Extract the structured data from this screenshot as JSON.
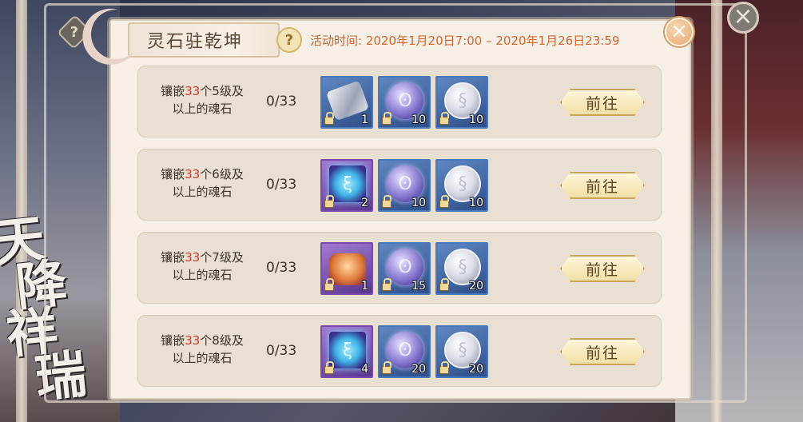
{
  "background": {
    "calligraphy": [
      "天",
      "降",
      "祥",
      "瑞"
    ]
  },
  "outer": {
    "help_icon": "?",
    "close_icon": "×"
  },
  "panel": {
    "title": "灵石驻乾坤",
    "help_icon": "?",
    "event_time_label": "活动时间:",
    "event_time_value": "2020年1月20日7:00 – 2020年1月26日23:59",
    "close_icon": "×"
  },
  "tasks": [
    {
      "desc_prefix": "镶嵌",
      "count": "33",
      "desc_suffix": "个5级及",
      "desc_line2": "以上的魂石",
      "progress": "0/33",
      "rewards": [
        {
          "icon": "crystal-shard-icon",
          "qty": "1"
        },
        {
          "icon": "purple-orb-icon",
          "qty": "10"
        },
        {
          "icon": "silver-coin-icon",
          "qty": "10"
        }
      ],
      "button": "前往"
    },
    {
      "desc_prefix": "镶嵌",
      "count": "33",
      "desc_suffix": "个6级及",
      "desc_line2": "以上的魂石",
      "progress": "0/33",
      "rewards": [
        {
          "icon": "rune-stone-icon",
          "qty": "2"
        },
        {
          "icon": "purple-orb-icon",
          "qty": "10"
        },
        {
          "icon": "silver-coin-icon",
          "qty": "10"
        }
      ],
      "button": "前往"
    },
    {
      "desc_prefix": "镶嵌",
      "count": "33",
      "desc_suffix": "个7级及",
      "desc_line2": "以上的魂石",
      "progress": "0/33",
      "rewards": [
        {
          "icon": "lantern-chest-icon",
          "qty": "1"
        },
        {
          "icon": "purple-orb-icon",
          "qty": "15"
        },
        {
          "icon": "silver-coin-icon",
          "qty": "20"
        }
      ],
      "button": "前往"
    },
    {
      "desc_prefix": "镶嵌",
      "count": "33",
      "desc_suffix": "个8级及",
      "desc_line2": "以上的魂石",
      "progress": "0/33",
      "rewards": [
        {
          "icon": "rune-stone-icon",
          "qty": "4"
        },
        {
          "icon": "purple-orb-icon",
          "qty": "20"
        },
        {
          "icon": "silver-coin-icon",
          "qty": "20"
        }
      ],
      "button": "前往"
    }
  ],
  "colors": {
    "accent_red": "#d43a2a",
    "event_time": "#d2682d",
    "panel_bg": "#f5efe6",
    "row_bg": "#e9dfd3"
  }
}
